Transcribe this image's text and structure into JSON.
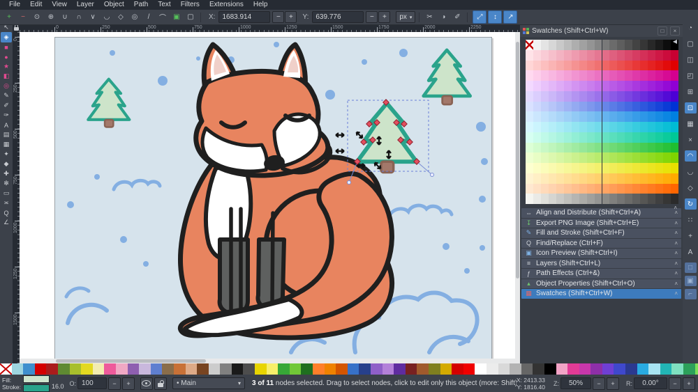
{
  "menu": {
    "items": [
      "File",
      "Edit",
      "View",
      "Layer",
      "Object",
      "Path",
      "Text",
      "Filters",
      "Extensions",
      "Help"
    ]
  },
  "node_toolbar": {
    "icons": [
      {
        "name": "insert-node",
        "glyph": "+",
        "cls": "green"
      },
      {
        "name": "delete-node",
        "glyph": "−",
        "cls": "red"
      },
      {
        "name": "break-path",
        "glyph": "⊙",
        "cls": ""
      },
      {
        "name": "join-nodes",
        "glyph": "⊕",
        "cls": ""
      },
      {
        "name": "join-with-segment",
        "glyph": "∪",
        "cls": ""
      },
      {
        "name": "delete-segment",
        "glyph": "∩",
        "cls": ""
      },
      {
        "name": "node-corner",
        "glyph": "∨",
        "cls": ""
      },
      {
        "name": "node-smooth",
        "glyph": "◡",
        "cls": ""
      },
      {
        "name": "node-symmetric",
        "glyph": "◇",
        "cls": ""
      },
      {
        "name": "node-auto",
        "glyph": "◎",
        "cls": ""
      },
      {
        "name": "segment-line",
        "glyph": "/",
        "cls": ""
      },
      {
        "name": "segment-curve",
        "glyph": "⌒",
        "cls": ""
      },
      {
        "name": "object-to-path",
        "glyph": "▣",
        "cls": "green"
      },
      {
        "name": "stroke-to-path",
        "glyph": "▢",
        "cls": ""
      }
    ],
    "x_label": "X:",
    "x_value": "1683.914",
    "y_label": "Y:",
    "y_value": "639.776",
    "minus": "−",
    "plus": "+",
    "unit": "px",
    "aux_icons": [
      {
        "name": "clip-edit",
        "glyph": "✂"
      },
      {
        "name": "mask-edit",
        "glyph": "◑"
      },
      {
        "name": "next-effect",
        "glyph": "✐"
      }
    ],
    "toggles": [
      {
        "name": "show-transform-handles",
        "glyph": "⤢"
      },
      {
        "name": "show-bezier-handles",
        "glyph": "↕"
      },
      {
        "name": "show-outline",
        "glyph": "↗"
      }
    ]
  },
  "tools": [
    {
      "name": "selector-tool",
      "glyph": "↖",
      "cls": ""
    },
    {
      "name": "node-tool",
      "glyph": "◈",
      "cls": "active"
    },
    {
      "name": "rectangle-tool",
      "glyph": "■",
      "cls": "pink"
    },
    {
      "name": "ellipse-tool",
      "glyph": "●",
      "cls": "pink"
    },
    {
      "name": "star-tool",
      "glyph": "★",
      "cls": "pink"
    },
    {
      "name": "box3d-tool",
      "glyph": "◧",
      "cls": "pink"
    },
    {
      "name": "spiral-tool",
      "glyph": "◎",
      "cls": "pink"
    },
    {
      "name": "pencil-tool",
      "glyph": "✎",
      "cls": ""
    },
    {
      "name": "bezier-tool",
      "glyph": "✐",
      "cls": ""
    },
    {
      "name": "calligraphy-tool",
      "glyph": "✑",
      "cls": ""
    },
    {
      "name": "text-tool",
      "glyph": "A",
      "cls": ""
    },
    {
      "name": "gradient-tool",
      "glyph": "▤",
      "cls": ""
    },
    {
      "name": "mesh-tool",
      "glyph": "▦",
      "cls": ""
    },
    {
      "name": "dropper-tool",
      "glyph": "✦",
      "cls": ""
    },
    {
      "name": "paint-bucket-tool",
      "glyph": "◆",
      "cls": ""
    },
    {
      "name": "tweak-tool",
      "glyph": "✚",
      "cls": ""
    },
    {
      "name": "spray-tool",
      "glyph": "✻",
      "cls": ""
    },
    {
      "name": "eraser-tool",
      "glyph": "▭",
      "cls": ""
    },
    {
      "name": "connector-tool",
      "glyph": "≍",
      "cls": ""
    },
    {
      "name": "zoom-tool",
      "glyph": "Q",
      "cls": ""
    },
    {
      "name": "measure-tool",
      "glyph": "∠",
      "cls": ""
    }
  ],
  "rulers": {
    "h_labels": [
      "0",
      "250",
      "500",
      "750",
      "1000",
      "1250",
      "1500",
      "1750",
      "2000",
      "2250"
    ],
    "v_labels": [
      "0",
      "250",
      "500",
      "750",
      "1000",
      "1250",
      "1500"
    ]
  },
  "dock": {
    "title": "Swatches (Shift+Ctrl+W)",
    "float_btn": "□",
    "close_btn": "×",
    "scroll_left": "◀",
    "scroll_up": "˄",
    "swatch_rows": [
      {
        "from": "#ffffff",
        "to": "#000000"
      },
      {
        "from": "#ffe3e8",
        "to": "#c80032"
      },
      {
        "from": "#ffd6d6",
        "to": "#e00000"
      },
      {
        "from": "#ffd9f0",
        "to": "#d4008f"
      },
      {
        "from": "#f3d9ff",
        "to": "#8f00d4"
      },
      {
        "from": "#e3d9ff",
        "to": "#4b00d4"
      },
      {
        "from": "#d9e1ff",
        "to": "#0032d4"
      },
      {
        "from": "#d6ecff",
        "to": "#0080e0"
      },
      {
        "from": "#d6f7ff",
        "to": "#00bcd4"
      },
      {
        "from": "#d6fff2",
        "to": "#00c896"
      },
      {
        "from": "#dcffd6",
        "to": "#1fbf30"
      },
      {
        "from": "#eeffd0",
        "to": "#7fd400"
      },
      {
        "from": "#fdffd0",
        "to": "#e8e000"
      },
      {
        "from": "#fff3d0",
        "to": "#ffaa00"
      },
      {
        "from": "#ffe8d0",
        "to": "#ff6600"
      },
      {
        "from": "#f5f5f0",
        "to": "#2b2b2b"
      }
    ],
    "panels": [
      {
        "label": "Align and Distribute (Shift+Ctrl+A)",
        "icon": "⇔",
        "icolor": "#cfd3d9",
        "selected": false
      },
      {
        "label": "Export PNG Image (Shift+Ctrl+E)",
        "icon": "↧",
        "icolor": "#6fc46f",
        "selected": false
      },
      {
        "label": "Fill and Stroke (Shift+Ctrl+F)",
        "icon": "✎",
        "icolor": "#7fb2e5",
        "selected": false
      },
      {
        "label": "Find/Replace (Ctrl+F)",
        "icon": "Q",
        "icolor": "#cfd3d9",
        "selected": false
      },
      {
        "label": "Icon Preview (Shift+Ctrl+I)",
        "icon": "▣",
        "icolor": "#7fb2e5",
        "selected": false
      },
      {
        "label": "Layers (Shift+Ctrl+L)",
        "icon": "≡",
        "icolor": "#cfd3d9",
        "selected": false
      },
      {
        "label": "Path Effects (Ctrl+&)",
        "icon": "ƒ",
        "icolor": "#cfd3d9",
        "selected": false
      },
      {
        "label": "Object Properties (Shift+Ctrl+O)",
        "icon": "▴",
        "icolor": "#6fc46f",
        "selected": false
      },
      {
        "label": "Swatches (Shift+Ctrl+W)",
        "icon": "▦",
        "icolor": "#e06868",
        "selected": true
      }
    ],
    "chevron": "˄"
  },
  "snapbar": {
    "icons": [
      {
        "name": "snap-enable",
        "glyph": "◔",
        "active": false
      },
      {
        "name": "snap-bbox",
        "glyph": "▢",
        "active": false
      },
      {
        "name": "snap-bbox-edges",
        "glyph": "◫",
        "active": false
      },
      {
        "name": "snap-bbox-corners",
        "glyph": "◰",
        "active": false
      },
      {
        "name": "snap-bbox-edge-midpoints",
        "glyph": "⊞",
        "active": false
      },
      {
        "name": "snap-bbox-centers",
        "glyph": "⊡",
        "active": true
      },
      {
        "name": "snap-nodes",
        "glyph": "▦",
        "active": false
      },
      {
        "name": "snap-intersections",
        "glyph": "×",
        "active": false
      },
      {
        "name": "snap-paths",
        "glyph": "◠",
        "active": true
      },
      {
        "name": "snap-cusp-nodes",
        "glyph": "◡",
        "active": false
      },
      {
        "name": "snap-smooth-nodes",
        "glyph": "◇",
        "active": false
      },
      {
        "name": "snap-midpoints",
        "glyph": "↻",
        "active": true
      },
      {
        "name": "snap-object-centers",
        "glyph": "∷",
        "active": false
      },
      {
        "name": "snap-rotation-centers",
        "glyph": "+",
        "active": false
      },
      {
        "name": "snap-text-baselines",
        "glyph": "A",
        "active": false
      }
    ],
    "squares": [
      {
        "name": "snap-page-border",
        "glyph": "□"
      },
      {
        "name": "snap-grids",
        "glyph": "▣"
      },
      {
        "name": "snap-guides",
        "glyph": "⌐"
      }
    ]
  },
  "palette": {
    "colors": [
      "#9ed5e0",
      "#3f8fce",
      "#d40000",
      "#aa1c1c",
      "#5f8a32",
      "#a8bf2c",
      "#e3d921",
      "#f2ecb0",
      "#ee5a9b",
      "#f0a8c4",
      "#8e5fb0",
      "#c9b8dd",
      "#5f7fd0",
      "#8a6d4a",
      "#c87137",
      "#deaa87",
      "#784421",
      "#cccccc",
      "#808080",
      "#1a1a1a",
      "#4d4d4d",
      "#e8d500",
      "#f7ef6a",
      "#37a737",
      "#71c837",
      "#1f6f1f",
      "#ff7f2a",
      "#ef8200",
      "#d45500",
      "#3771c8",
      "#27408b",
      "#8f5fc8",
      "#b380d9",
      "#5f2ca0",
      "#782121",
      "#a05a2c",
      "#7f7f1f",
      "#d4aa00",
      "#d40000",
      "#f00000",
      "#ffffff",
      "#ececec",
      "#d9d9d9",
      "#b3b3b3",
      "#666666",
      "#333333",
      "#000000",
      "#f2a3c6",
      "#e23b96",
      "#c837ab",
      "#8e2fa8",
      "#6f3fd4",
      "#3f48cc",
      "#2b3990",
      "#29abe2",
      "#a8e4f2",
      "#22b5b5",
      "#7fe0c0",
      "#2ca05a",
      "#7ddf5a",
      "#37a737",
      "#ffe680"
    ]
  },
  "statusbar": {
    "fill_label": "Fill:",
    "stroke_label": "Stroke:",
    "fill_color": "#cfe5cd",
    "stroke_color": "#2aa38b",
    "stroke_width": "16.0",
    "opacity_label": "O:",
    "opacity_value": "100",
    "minus": "−",
    "plus": "+",
    "layer_bullet": "•",
    "layer_name": "Main",
    "dd_arrow": "▾",
    "message_bold": "3 of 11",
    "message_rest": " nodes selected. Drag to select nodes, click to edit only this object (more: Shift)",
    "x_label": "X:",
    "x_value": "2413.33",
    "y_label": "Y:",
    "y_value": "1816.40",
    "z_label": "Z:",
    "zoom_value": "50%",
    "r_label": "R:",
    "rotation_value": "0.00°"
  },
  "canvas_colors": {
    "page_background": "#d6e3ec",
    "snow_dot": "#84afe2",
    "fox_orange": "#e8845f",
    "fox_white": "#ffffff",
    "outline": "#1f1f1f",
    "sock_gray": "#5e605f",
    "ear_pink": "#f0d0c9",
    "tree_fill": "#cde4ca",
    "tree_stroke": "#2aa38b",
    "trunk_fill": "#a3786a",
    "selection_dash": "#6b7fd7",
    "node_red": "#e34f5f"
  }
}
